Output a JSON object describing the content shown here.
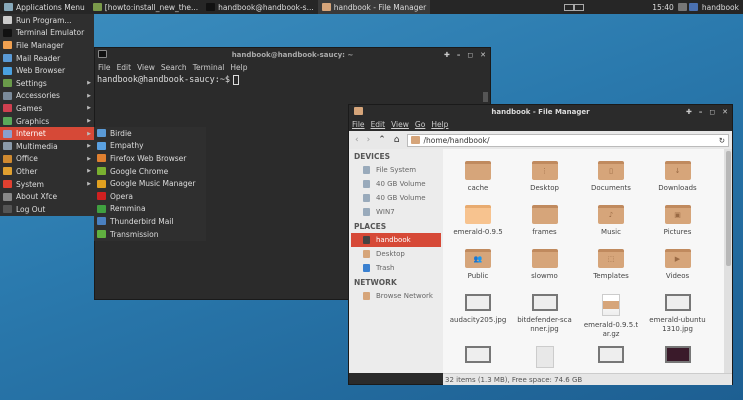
{
  "panel": {
    "app_menu": "Applications Menu",
    "tasks": [
      {
        "label": "[howto:install_new_the...",
        "color": "#7a9a4a"
      },
      {
        "label": "handbook@handbook-s...",
        "color": "#111111"
      },
      {
        "label": "handbook - File Manager",
        "color": "#d6a57a"
      }
    ],
    "clock": "15:40",
    "user": "handbook"
  },
  "menu": {
    "items": [
      {
        "label": "Run Program...",
        "icon": "run-icon",
        "color": "#cccccc"
      },
      {
        "label": "Terminal Emulator",
        "icon": "terminal-icon",
        "color": "#111111"
      },
      {
        "label": "File Manager",
        "icon": "folder-icon",
        "color": "#f0a050"
      },
      {
        "label": "Mail Reader",
        "icon": "mail-icon",
        "color": "#5a9ad6"
      },
      {
        "label": "Web Browser",
        "icon": "globe-icon",
        "color": "#4aa0e0"
      },
      {
        "label": "Settings",
        "icon": "settings-icon",
        "color": "#6a9a4a",
        "sub": true
      },
      {
        "label": "Accessories",
        "icon": "accessories-icon",
        "color": "#7a8a9a",
        "sub": true
      },
      {
        "label": "Games",
        "icon": "games-icon",
        "color": "#d04050",
        "sub": true
      },
      {
        "label": "Graphics",
        "icon": "graphics-icon",
        "color": "#5aaa5a",
        "sub": true
      },
      {
        "label": "Internet",
        "icon": "internet-icon",
        "color": "#8aa0d0",
        "sub": true,
        "selected": true
      },
      {
        "label": "Multimedia",
        "icon": "multimedia-icon",
        "color": "#8a9aaa",
        "sub": true
      },
      {
        "label": "Office",
        "icon": "office-icon",
        "color": "#d08a30",
        "sub": true
      },
      {
        "label": "Other",
        "icon": "other-icon",
        "color": "#e0a030",
        "sub": true
      },
      {
        "label": "System",
        "icon": "system-icon",
        "color": "#e04030",
        "sub": true
      },
      {
        "label": "About Xfce",
        "icon": "star-icon",
        "color": "#888888"
      },
      {
        "label": "Log Out",
        "icon": "logout-icon",
        "color": "#555555"
      }
    ]
  },
  "submenu": {
    "items": [
      {
        "label": "Birdie",
        "color": "#5a9ad6"
      },
      {
        "label": "Empathy",
        "color": "#5aa0e0"
      },
      {
        "label": "Firefox Web Browser",
        "color": "#e08030"
      },
      {
        "label": "Google Chrome",
        "color": "#7ab030"
      },
      {
        "label": "Google Music Manager",
        "color": "#e0a020"
      },
      {
        "label": "Opera",
        "color": "#d02020"
      },
      {
        "label": "Remmina",
        "color": "#40a040"
      },
      {
        "label": "Thunderbird Mail",
        "color": "#4a80c0"
      },
      {
        "label": "Transmission",
        "color": "#60b040"
      }
    ]
  },
  "terminal": {
    "title": "handbook@handbook-saucy: ~",
    "menu": [
      "File",
      "Edit",
      "View",
      "Search",
      "Terminal",
      "Help"
    ],
    "prompt": "handbook@handbook-saucy:~$"
  },
  "file_manager": {
    "title": "handbook - File Manager",
    "menu": [
      "File",
      "Edit",
      "View",
      "Go",
      "Help"
    ],
    "path": "/home/handbook/",
    "sidebar": [
      {
        "header": "DEVICES",
        "items": [
          {
            "label": "File System"
          },
          {
            "label": "40 GB Volume"
          },
          {
            "label": "40 GB Volume"
          },
          {
            "label": "WIN7"
          }
        ]
      },
      {
        "header": "PLACES",
        "items": [
          {
            "label": "handbook",
            "selected": true
          },
          {
            "label": "Desktop"
          },
          {
            "label": "Trash"
          }
        ]
      },
      {
        "header": "NETWORK",
        "items": [
          {
            "label": "Browse Network"
          }
        ]
      }
    ],
    "files": [
      {
        "name": "cache",
        "type": "folder"
      },
      {
        "name": "Desktop",
        "type": "folder",
        "glyph": "⋮"
      },
      {
        "name": "Documents",
        "type": "folder",
        "glyph": "▯"
      },
      {
        "name": "Downloads",
        "type": "folder",
        "glyph": "↓"
      },
      {
        "name": "emerald-0.9.5",
        "type": "folder-light"
      },
      {
        "name": "frames",
        "type": "folder"
      },
      {
        "name": "Music",
        "type": "folder",
        "glyph": "♪"
      },
      {
        "name": "Pictures",
        "type": "folder",
        "glyph": "▣"
      },
      {
        "name": "Public",
        "type": "folder",
        "glyph": "👥"
      },
      {
        "name": "slowmo",
        "type": "folder"
      },
      {
        "name": "Templates",
        "type": "folder",
        "glyph": "⬚"
      },
      {
        "name": "Videos",
        "type": "folder",
        "glyph": "▶"
      },
      {
        "name": "audacity205.jpg",
        "type": "image"
      },
      {
        "name": "bitdefender-scanner.jpg",
        "type": "image"
      },
      {
        "name": "emerald-0.9.5.tar.gz",
        "type": "archive"
      },
      {
        "name": "emerald-ubuntu1310.jpg",
        "type": "image"
      },
      {
        "name": "",
        "type": "image"
      },
      {
        "name": "",
        "type": "script"
      },
      {
        "name": "",
        "type": "image"
      },
      {
        "name": "",
        "type": "image-dark"
      }
    ],
    "status": "32 items (1.3 MB), Free space: 74.6 GB"
  },
  "colors": {
    "accent": "#d64937",
    "panel": "#262626",
    "folder": "#d6a57a"
  }
}
